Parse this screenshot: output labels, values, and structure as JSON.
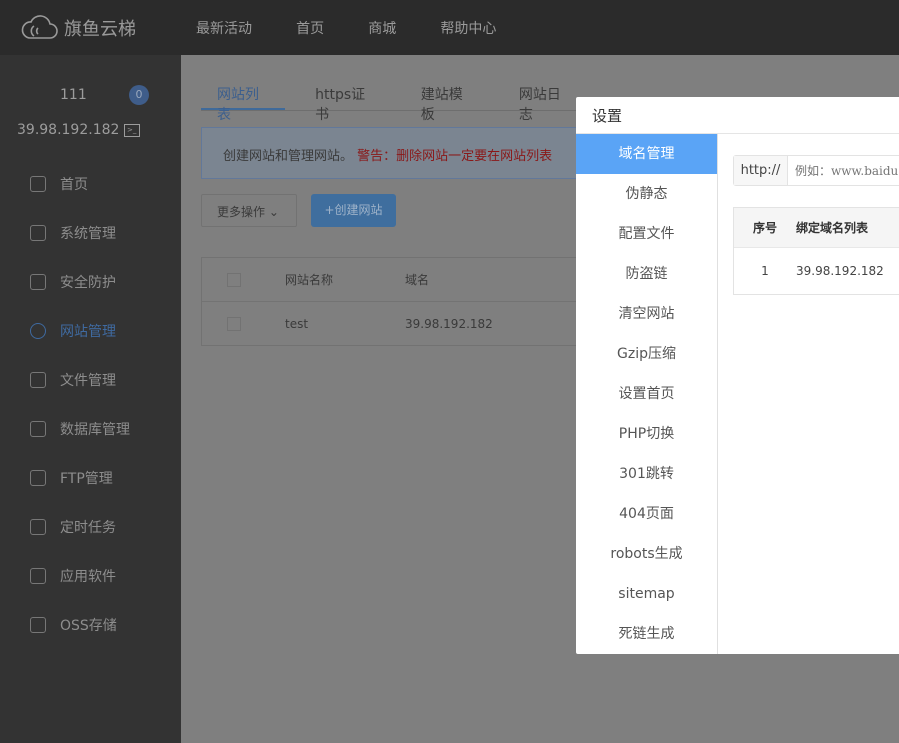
{
  "header": {
    "brand": "旗鱼云梯",
    "nav": [
      "最新活动",
      "首页",
      "商城",
      "帮助中心"
    ]
  },
  "sidebar": {
    "user": "111",
    "badge": "0",
    "ip": "39.98.192.182",
    "items": [
      {
        "label": "首页",
        "icon": "home-icon"
      },
      {
        "label": "系统管理",
        "icon": "gear-icon"
      },
      {
        "label": "安全防护",
        "icon": "shield-icon"
      },
      {
        "label": "网站管理",
        "icon": "globe-icon",
        "active": true
      },
      {
        "label": "文件管理",
        "icon": "folder-icon"
      },
      {
        "label": "数据库管理",
        "icon": "database-icon"
      },
      {
        "label": "FTP管理",
        "icon": "ftp-icon"
      },
      {
        "label": "定时任务",
        "icon": "clock-icon"
      },
      {
        "label": "应用软件",
        "icon": "apps-icon"
      },
      {
        "label": "OSS存储",
        "icon": "cloud-icon"
      }
    ]
  },
  "main": {
    "tabs": [
      "网站列表",
      "https证书",
      "建站模板",
      "网站日志"
    ],
    "info": "创建网站和管理网站。",
    "warning": "警告：删除网站一定要在网站列表",
    "more_label": "更多操作 ⌄",
    "create_label": "+创建网站",
    "table": {
      "headers": [
        "网站名称",
        "域名"
      ],
      "rows": [
        [
          "test",
          "39.98.192.182"
        ]
      ]
    }
  },
  "modal": {
    "title": "设置",
    "menu": [
      "域名管理",
      "伪静态",
      "配置文件",
      "防盗链",
      "清空网站",
      "Gzip压缩",
      "设置首页",
      "PHP切换",
      "301跳转",
      "404页面",
      "robots生成",
      "sitemap",
      "死链生成"
    ],
    "prefix": "http://",
    "placeholder": "例如：www.baidu.com",
    "table": {
      "headers": [
        "序号",
        "绑定域名列表"
      ],
      "rows": [
        [
          "1",
          "39.98.192.182"
        ]
      ]
    }
  },
  "colors": {
    "accent": "#5aa4f6",
    "warning": "#d02020"
  }
}
